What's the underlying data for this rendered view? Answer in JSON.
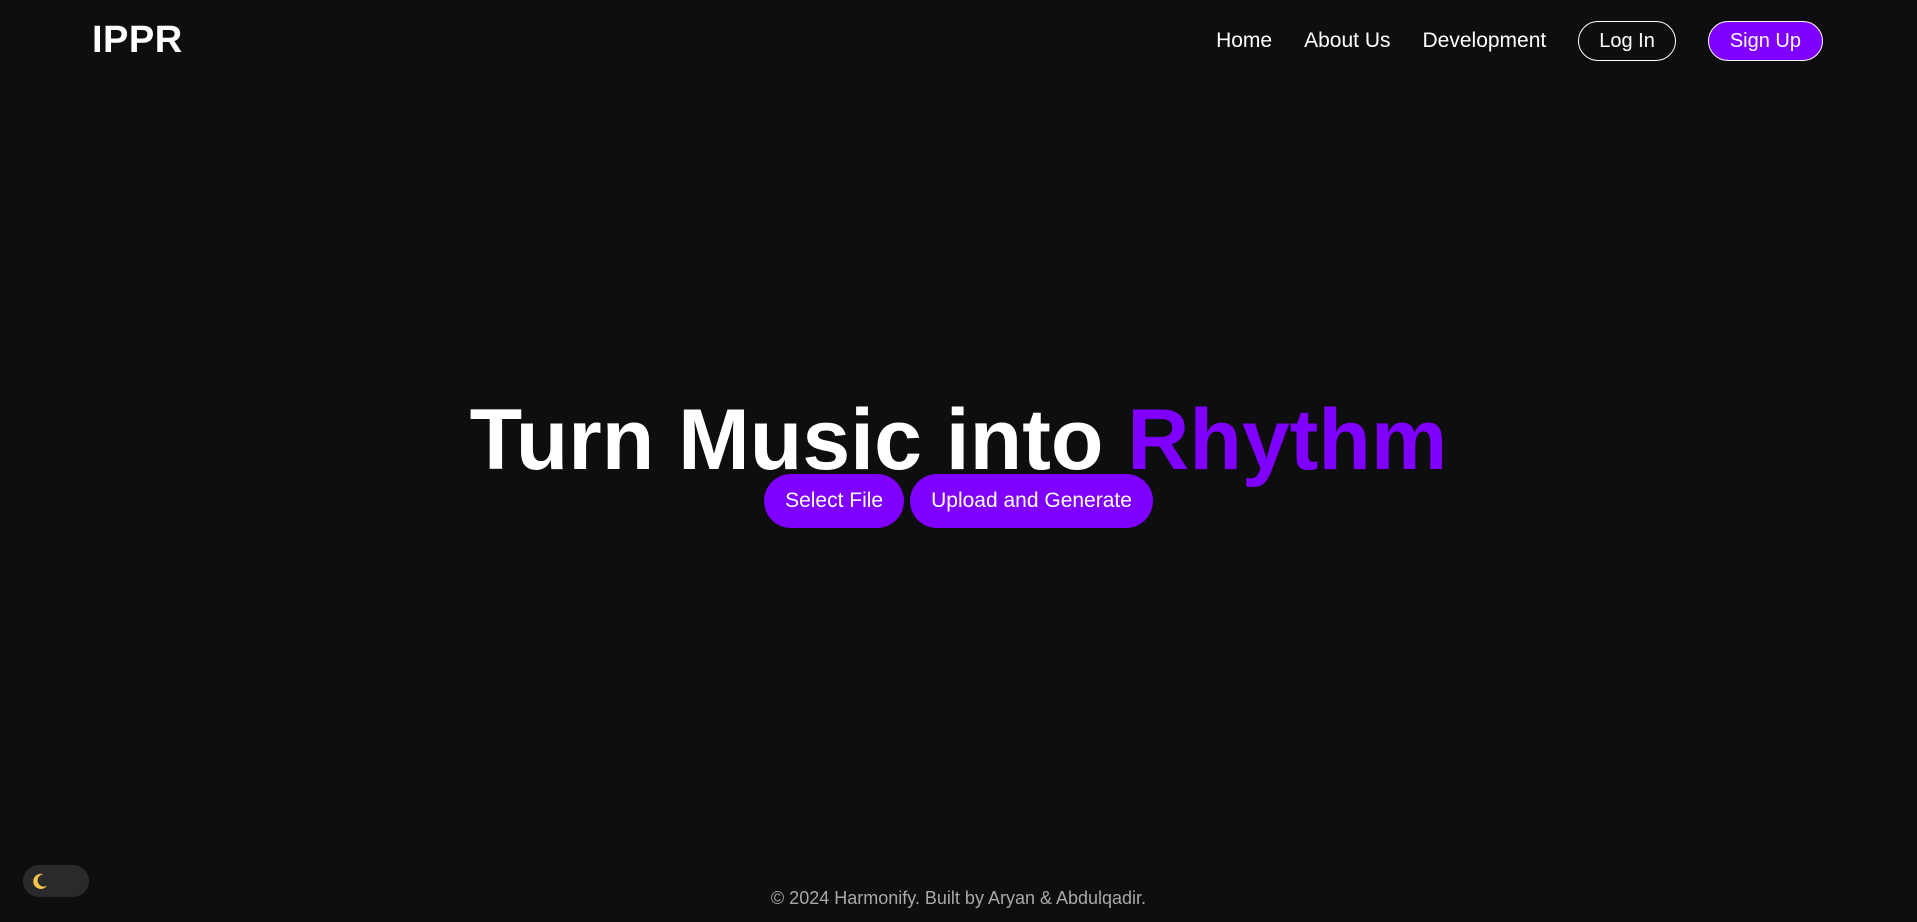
{
  "header": {
    "logo": "IPPR",
    "nav": {
      "home": "Home",
      "about": "About Us",
      "development": "Development"
    },
    "login_label": "Log In",
    "signup_label": "Sign Up"
  },
  "hero": {
    "title_main": "Turn Music into ",
    "title_accent": "Rhythm",
    "select_file_label": "Select File",
    "upload_label": "Upload and Generate"
  },
  "footer": {
    "text": "© 2024 Harmonify. Built by Aryan & Abdulqadir."
  },
  "theme_toggle": {
    "icon": "moon-icon"
  },
  "colors": {
    "background": "#0e0e0e",
    "accent": "#7f00ff",
    "footer_text": "#a8a8a8",
    "toggle_bg": "#2a2a2d"
  }
}
